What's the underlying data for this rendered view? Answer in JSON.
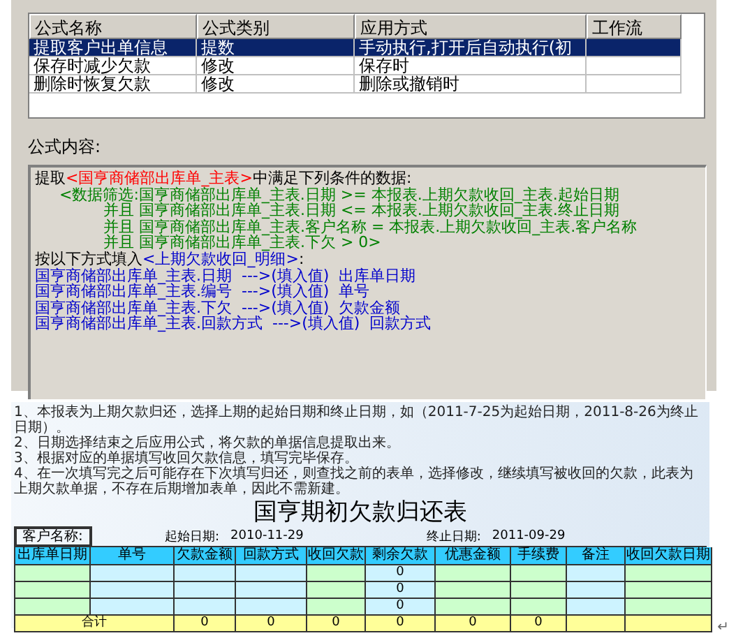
{
  "formula_list": {
    "columns": [
      "公式名称",
      "公式类别",
      "应用方式",
      "工作流"
    ],
    "rows": [
      {
        "cells": [
          "提取客户出单信息",
          "提数",
          "手动执行,打开后自动执行(初",
          ""
        ],
        "selected": true
      },
      {
        "cells": [
          "保存时减少欠款",
          "修改",
          "保存时",
          ""
        ],
        "selected": false
      },
      {
        "cells": [
          "删除时恢复欠款",
          "修改",
          "删除或撤销时",
          ""
        ],
        "selected": false
      }
    ]
  },
  "formula_content": {
    "label": "公式内容:",
    "lines": [
      {
        "segments": [
          {
            "text": "提取",
            "color": "#000000"
          },
          {
            "text": "<国亨商储部出库单_主表>",
            "color": "#ff0000"
          },
          {
            "text": "中满足下列条件的数据:",
            "color": "#000000"
          }
        ]
      },
      {
        "segments": [
          {
            "text": "     <数据筛选:国亨商储部出库单_主表.日期 >= 本报表.上期欠款收回_主表.起始日期",
            "color": "#008000"
          }
        ]
      },
      {
        "segments": [
          {
            "text": "              并且 国亨商储部出库单_主表.日期 <= 本报表.上期欠款收回_主表.终止日期",
            "color": "#008000"
          }
        ]
      },
      {
        "segments": [
          {
            "text": "              并且 国亨商储部出库单_主表.客户名称 = 本报表.上期欠款收回_主表.客户名称",
            "color": "#008000"
          }
        ]
      },
      {
        "segments": [
          {
            "text": "              并且 国亨商储部出库单_主表.下欠 > 0>",
            "color": "#008000"
          }
        ]
      },
      {
        "segments": [
          {
            "text": "按以下方式填入",
            "color": "#000000"
          },
          {
            "text": "<上期欠款收回_明细>",
            "color": "#0000cc"
          },
          {
            "text": ":",
            "color": "#000000"
          }
        ]
      },
      {
        "segments": [
          {
            "text": "国亨商储部出库单_主表.日期  --->(填入值)  出库单日期",
            "color": "#0000cc"
          }
        ]
      },
      {
        "segments": [
          {
            "text": "国亨商储部出库单_主表.编号  --->(填入值)  单号",
            "color": "#0000cc"
          }
        ]
      },
      {
        "segments": [
          {
            "text": "国亨商储部出库单_主表.下欠  --->(填入值)  欠款金额",
            "color": "#0000cc"
          }
        ]
      },
      {
        "segments": [
          {
            "text": "国亨商储部出库单_主表.回款方式  --->(填入值)  回款方式",
            "color": "#0000cc"
          }
        ]
      }
    ]
  },
  "notes": [
    "1、本报表为上期欠款归还，选择上期的起始日期和终止日期，如（2011-7-25为起始日期，2011-8-26为终止日期）。",
    "2、日期选择结束之后应用公式，将欠款的单据信息提取出来。",
    "3、根据对应的单据填写收回欠款信息，填写完毕保存。",
    "4、在一次填写完之后可能存在下次填写归还，则查找之前的表单，选择修改，继续填写被收回的欠款，此表为上期欠款单据，不存在后期增加表单，因此不需新建。"
  ],
  "sheet": {
    "title": "国亨期初欠款归还表",
    "customer_label": "客户名称:",
    "start_label": "起始日期:",
    "start_date": "2010-11-29",
    "end_label": "终止日期:",
    "end_date": "2011-09-29",
    "columns": [
      {
        "label": "出库单日期",
        "color": "#ccffcc"
      },
      {
        "label": "单号",
        "color": "#cdf3ff"
      },
      {
        "label": "欠款金额",
        "color": "#cdf3ff"
      },
      {
        "label": "回款方式",
        "color": "#cdf3ff"
      },
      {
        "label": "收回欠款",
        "color": "#ccffcc"
      },
      {
        "label": "剩余欠款",
        "color": "#cdf3ff"
      },
      {
        "label": "优惠金额",
        "color": "#ccffcc"
      },
      {
        "label": "手续费",
        "color": "#ccffcc"
      },
      {
        "label": "备注",
        "color": "#cdf3ff"
      },
      {
        "label": "收回欠款日期",
        "color": "#ccffcc"
      }
    ],
    "rows": [
      {
        "cells": [
          "",
          "",
          "",
          "",
          "",
          "0",
          "",
          "",
          "",
          ""
        ]
      },
      {
        "cells": [
          "",
          "",
          "",
          "",
          "",
          "0",
          "",
          "",
          "",
          ""
        ]
      },
      {
        "cells": [
          "",
          "",
          "",
          "",
          "",
          "0",
          "",
          "",
          "",
          ""
        ]
      }
    ],
    "total": {
      "label": "合计",
      "cells": [
        "0",
        "0",
        "0",
        "0",
        "0",
        "0",
        "",
        ""
      ]
    }
  },
  "paragraph_mark": "↵"
}
